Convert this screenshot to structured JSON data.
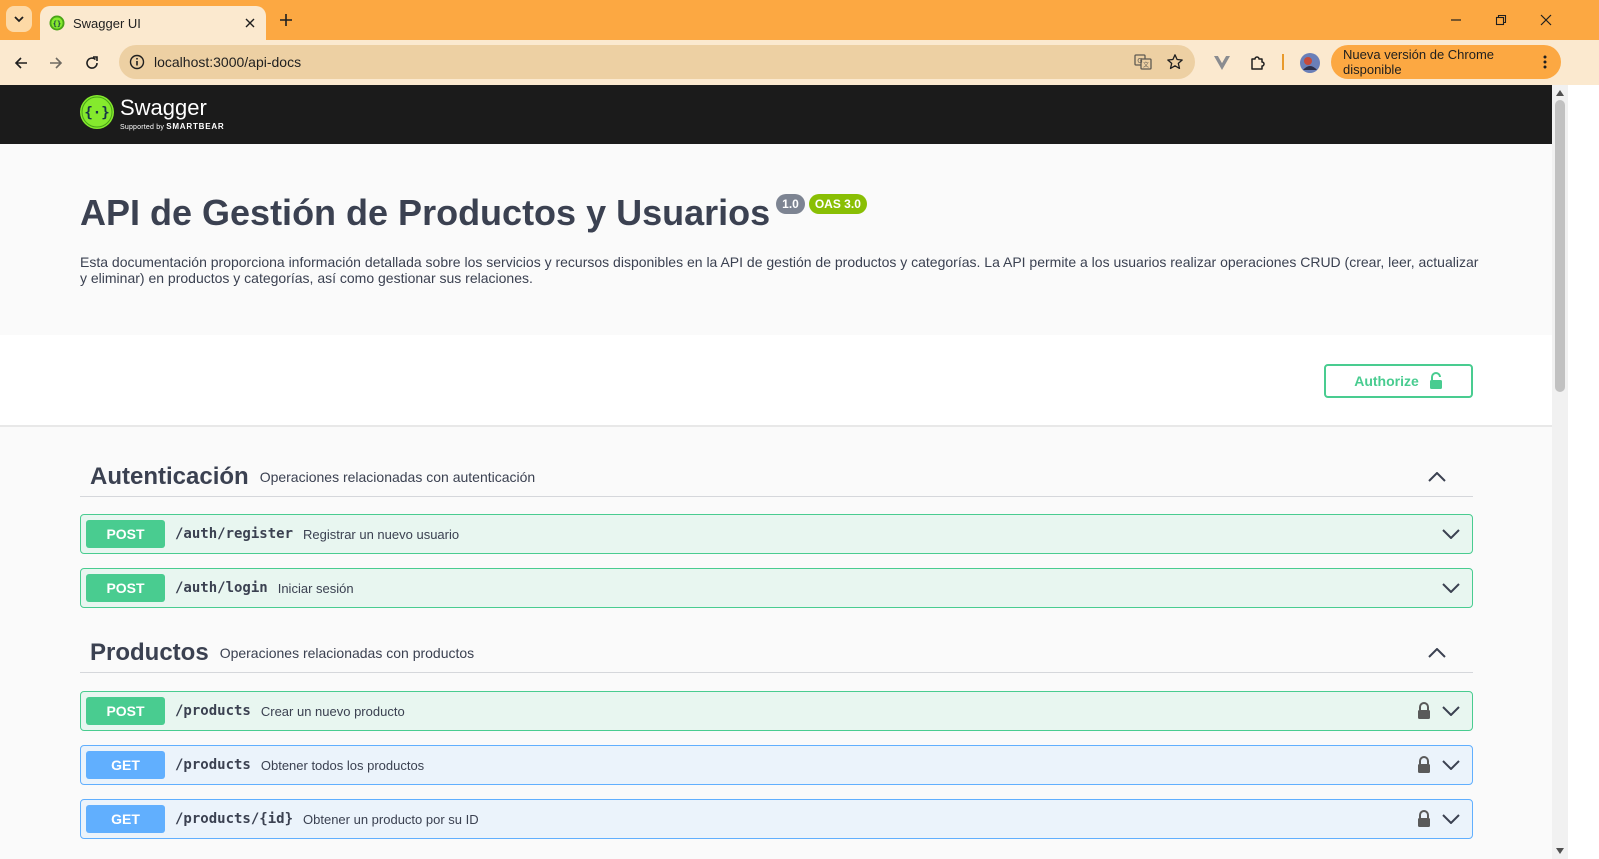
{
  "browser": {
    "tab_title": "Swagger UI",
    "url": "localhost:3000/api-docs",
    "update_label": "Nueva versión de Chrome disponible"
  },
  "swagger": {
    "logo_name": "Swagger",
    "logo_supported": "Supported by",
    "logo_brand": "SMARTBEAR"
  },
  "info": {
    "title": "API de Gestión de Productos y Usuarios",
    "version": "1.0",
    "oas": "OAS 3.0",
    "description": "Esta documentación proporciona información detallada sobre los servicios y recursos disponibles en la API de gestión de productos y categorías. La API permite a los usuarios realizar operaciones CRUD (crear, leer, actualizar y eliminar) en productos y categorías, así como gestionar sus relaciones."
  },
  "authorize_label": "Authorize",
  "tags": [
    {
      "name": "Autenticación",
      "description": "Operaciones relacionadas con autenticación",
      "operations": [
        {
          "method": "POST",
          "path": "/auth/register",
          "summary": "Registrar un nuevo usuario"
        },
        {
          "method": "POST",
          "path": "/auth/login",
          "summary": "Iniciar sesión"
        }
      ]
    },
    {
      "name": "Productos",
      "description": "Operaciones relacionadas con productos",
      "operations": [
        {
          "method": "POST",
          "path": "/products",
          "summary": "Crear un nuevo producto"
        },
        {
          "method": "GET",
          "path": "/products",
          "summary": "Obtener todos los productos"
        },
        {
          "method": "GET",
          "path": "/products/{id}",
          "summary": "Obtener un producto por su ID"
        }
      ]
    }
  ],
  "colors": {
    "post": "#49cc90",
    "get": "#61affe",
    "chrome_accent": "#fca842"
  }
}
